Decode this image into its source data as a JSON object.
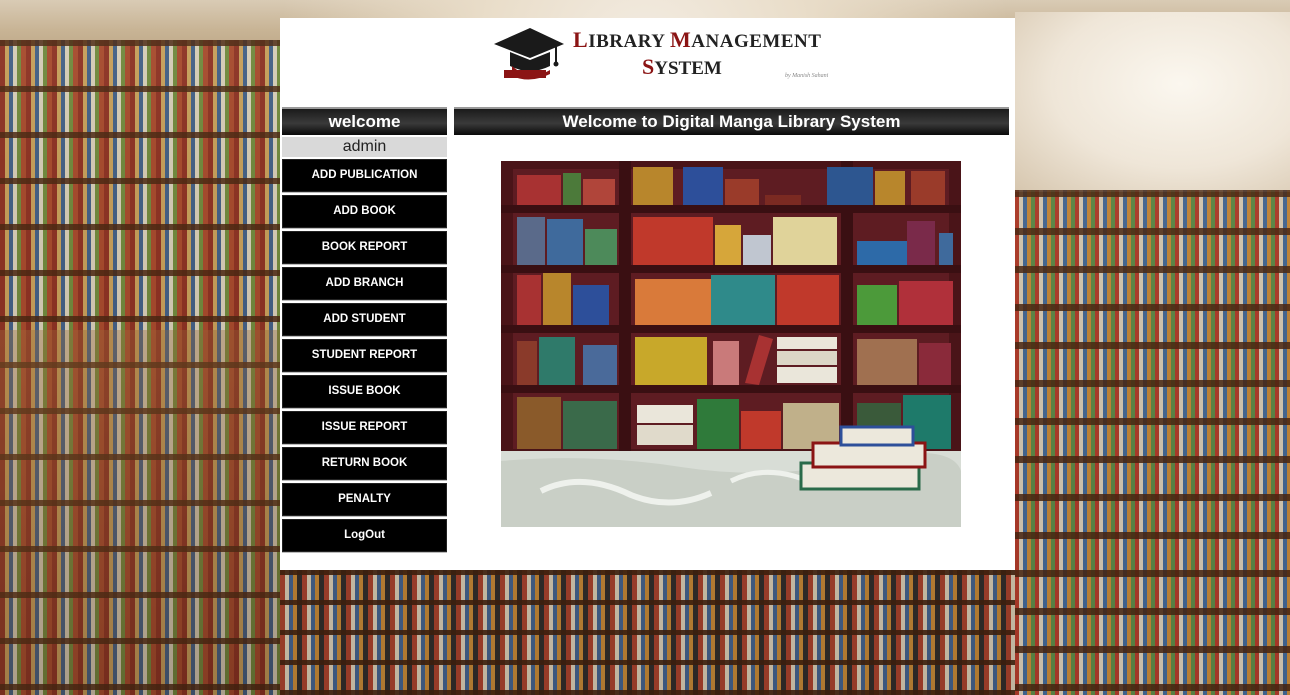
{
  "header": {
    "title_line1_first": "L",
    "title_line1_rest": "IBRARY ",
    "title_line1_second_cap": "M",
    "title_line1_second_rest": "ANAGEMENT",
    "title_line2_cap": "S",
    "title_line2_rest": "YSTEM",
    "byline": "by Manish Sahani"
  },
  "sidebar": {
    "welcome": "welcome",
    "user": "admin",
    "items": [
      {
        "label": "ADD PUBLICATION"
      },
      {
        "label": "ADD BOOK"
      },
      {
        "label": "BOOK REPORT"
      },
      {
        "label": "ADD BRANCH"
      },
      {
        "label": "ADD STUDENT"
      },
      {
        "label": "STUDENT REPORT"
      },
      {
        "label": "ISSUE BOOK"
      },
      {
        "label": "ISSUE REPORT"
      },
      {
        "label": "RETURN BOOK"
      },
      {
        "label": "PENALTY"
      },
      {
        "label": "LogOut"
      }
    ]
  },
  "main": {
    "heading": "Welcome to Digital Manga Library System"
  },
  "colors": {
    "accent": "#8b1414",
    "menu_bg": "#000000",
    "panel_bg": "#ffffff"
  }
}
